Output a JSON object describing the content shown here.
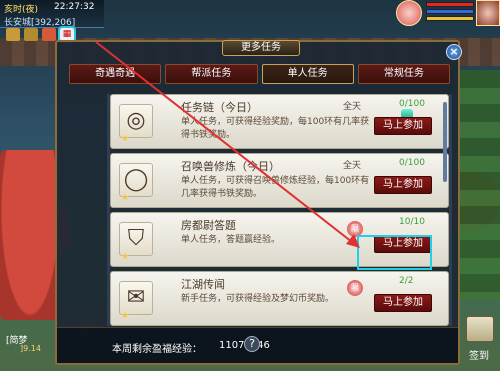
{
  "hud": {
    "time_label": "亥时(夜)",
    "clock": "22:27:32",
    "location": "长安城[392,206]",
    "calendar_icon": "calendar-icon"
  },
  "dialog": {
    "title": "更多任务",
    "tabs": [
      {
        "label": "奇遇奇遇",
        "active": false
      },
      {
        "label": "帮派任务",
        "active": false
      },
      {
        "label": "单人任务",
        "active": true
      },
      {
        "label": "常规任务",
        "active": false
      }
    ],
    "tasks": [
      {
        "name": "任务链（今日）",
        "desc": "单人任务，可获得经验奖励，每100环有几率获得书铁奖励。",
        "timing": "全天",
        "count": "0/100",
        "button": "马上参加",
        "icon": "bead-bracelet-icon",
        "reward_icon": "gem-icon"
      },
      {
        "name": "召唤兽修炼（今日）",
        "desc": "单人任务，可获得召唤兽修炼经验，每100环有几率获得书铁奖励。",
        "timing": "全天",
        "count": "0/100",
        "button": "马上参加",
        "icon": "bead-necklace-icon"
      },
      {
        "name": "房都尉答题",
        "desc": "单人任务，答题赢经验。",
        "timing": "",
        "count": "10/10",
        "button": "马上参加",
        "icon": "shield-icon",
        "seal": "限"
      },
      {
        "name": "江湖传闻",
        "desc": "新手任务，可获得经验及梦幻币奖励。",
        "timing": "",
        "count": "2/2",
        "button": "马上参加",
        "icon": "scroll-icon",
        "seal": "限"
      }
    ],
    "footer_label": "本周剩余盈福经验：",
    "footer_value": "11074746",
    "help": "?"
  },
  "bottom": {
    "name": "[简梦",
    "name2": "]9.14",
    "char_label": "太清",
    "signin_label": "签到"
  },
  "colors": {
    "highlight": "#1fd0e8",
    "arrow": "#e03030",
    "button": "#8a1a16"
  }
}
